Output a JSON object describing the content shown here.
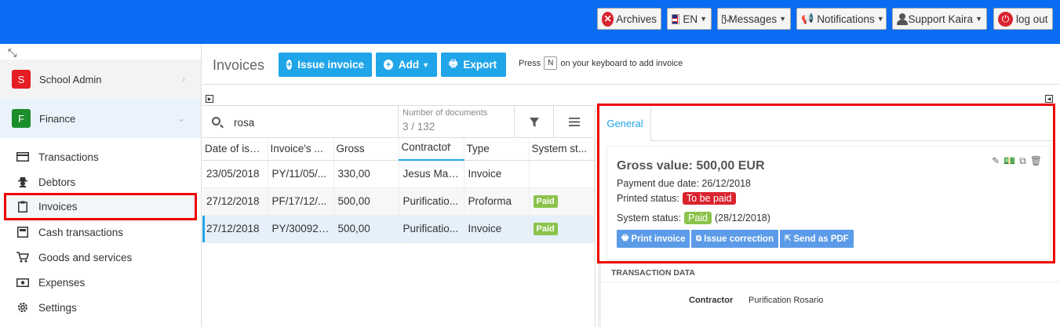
{
  "topbar": {
    "archives": "Archives",
    "language": "EN",
    "messages": "Messages",
    "notifications": "Notifications",
    "user": "Support Kaira",
    "logout": "log out",
    "bg_color": "#0a6cf2"
  },
  "sidebar": {
    "modules": [
      {
        "letter": "S",
        "label": "School Admin",
        "color": "#e51c23"
      },
      {
        "letter": "F",
        "label": "Finance",
        "color": "#1b8e2b"
      }
    ],
    "items": [
      {
        "label": "Transactions",
        "icon": "credit-card-icon"
      },
      {
        "label": "Debtors",
        "icon": "spy-icon"
      },
      {
        "label": "Invoices",
        "icon": "clipboard-icon"
      },
      {
        "label": "Cash transactions",
        "icon": "cash-register-icon"
      },
      {
        "label": "Goods and services",
        "icon": "cart-icon"
      },
      {
        "label": "Expenses",
        "icon": "money-icon"
      },
      {
        "label": "Settings",
        "icon": "gear-icon"
      }
    ]
  },
  "main": {
    "title": "Invoices",
    "issue_invoice": "Issue invoice",
    "add": "Add",
    "export": "Export",
    "hint_before": "Press",
    "hint_key": "N",
    "hint_after": "on your keyboard to add invoice"
  },
  "list": {
    "search_value": "rosa",
    "doc_count_label": "Number of documents",
    "doc_count_value": "3 / 132",
    "columns": [
      "Date of issue",
      "Invoice's ...",
      "Gross",
      "Contractor",
      "Type",
      "System st..."
    ],
    "rows": [
      {
        "date": "23/05/2018",
        "number": "PY/11/05/...",
        "gross": "330,00",
        "contractor": "Jesus Mar...",
        "type": "Invoice",
        "status": ""
      },
      {
        "date": "27/12/2018",
        "number": "PF/17/12/...",
        "gross": "500,00",
        "contractor": "Purificatio...",
        "type": "Proforma",
        "status": "Paid"
      },
      {
        "date": "27/12/2018",
        "number": "PY/300925...",
        "gross": "500,00",
        "contractor": "Purificatio...",
        "type": "Invoice",
        "status": "Paid"
      }
    ]
  },
  "detail": {
    "tab_general": "General",
    "gross_value": "Gross value: 500,00 EUR",
    "due_label": "Payment due date:",
    "due_value": "26/12/2018",
    "printed_label": "Printed status:",
    "printed_value": "To be paid",
    "system_label": "System status:",
    "system_value": "Paid",
    "system_date": "(28/12/2018)",
    "print_invoice": "Print invoice",
    "issue_correction": "Issue correction",
    "send_pdf": "Send as PDF",
    "transaction_data": "TRANSACTION DATA",
    "contractor_label": "Contractor",
    "contractor_value": "Purification Rosario"
  }
}
